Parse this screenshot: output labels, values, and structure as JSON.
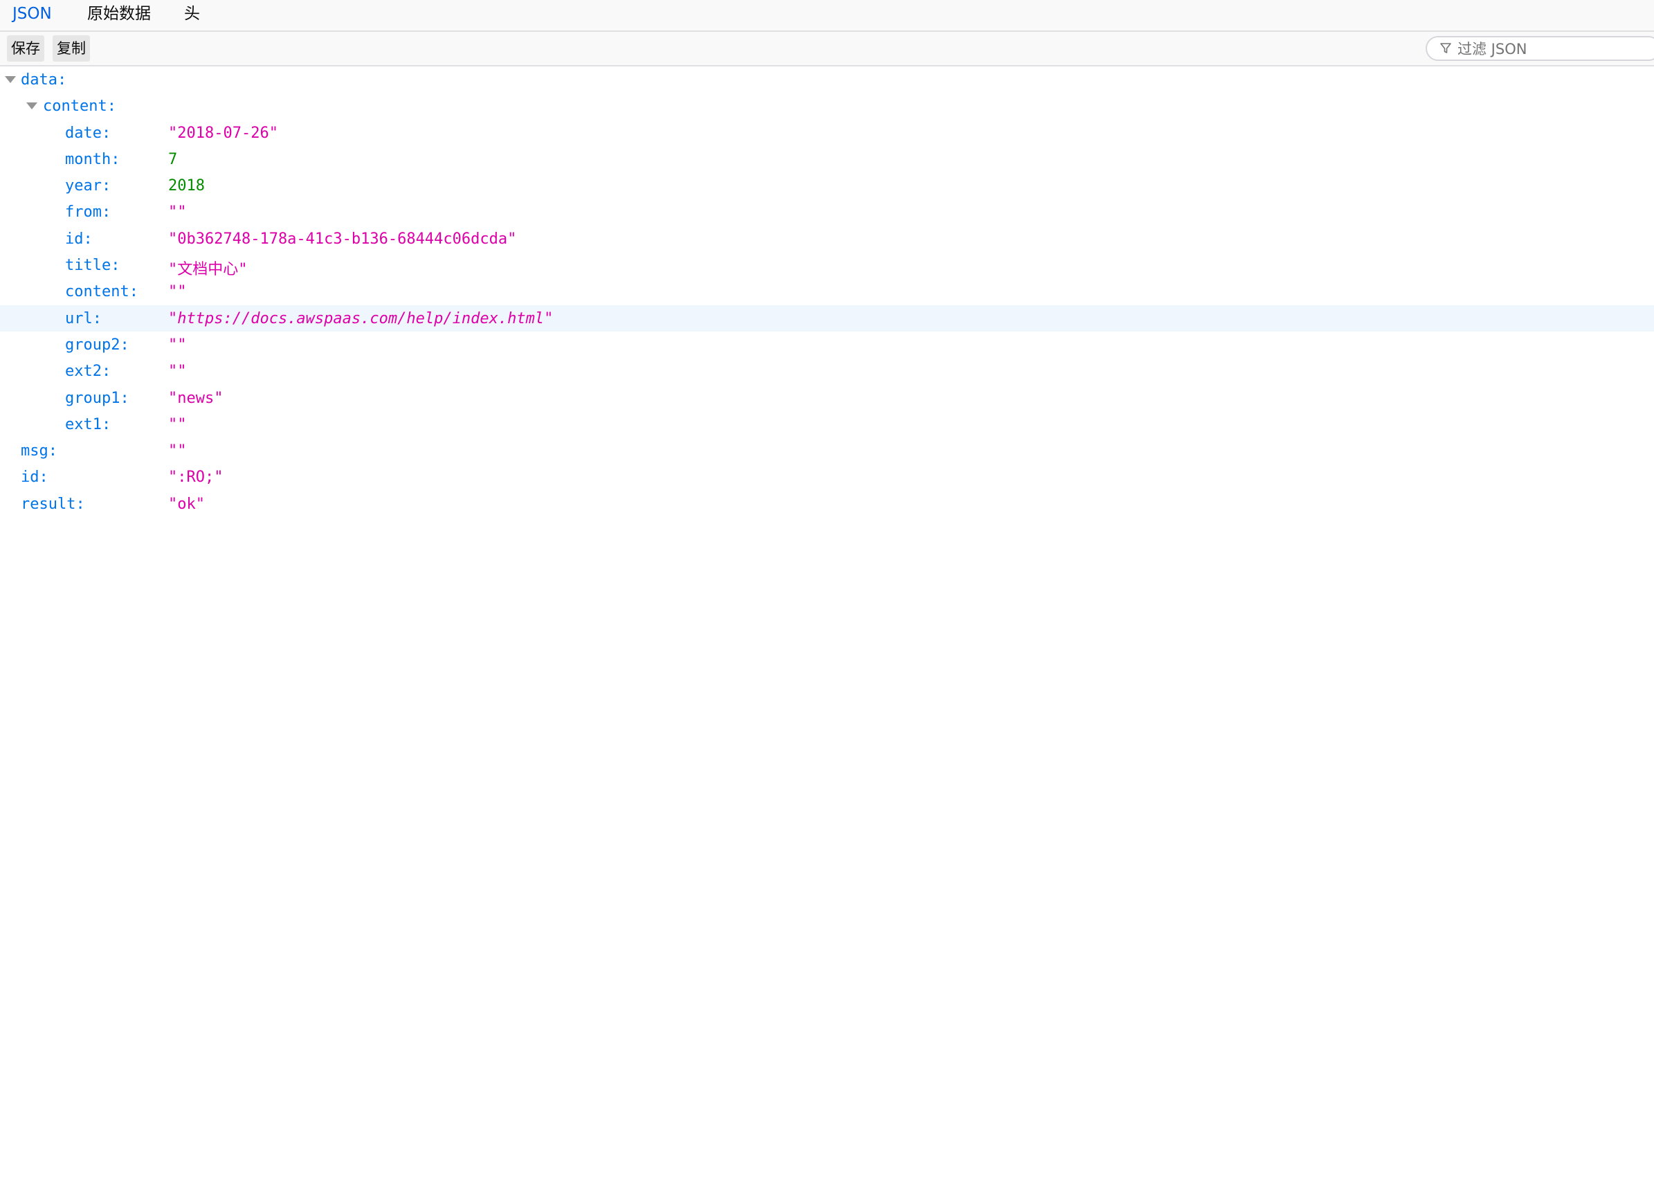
{
  "tabs": {
    "json": "JSON",
    "raw": "原始数据",
    "headers": "头"
  },
  "toolbar": {
    "save_label": "保存",
    "copy_label": "复制",
    "filter_placeholder": "过滤 JSON",
    "filter_icon": "funnel-icon"
  },
  "tree": {
    "data_key": "data:",
    "content_key": "content:",
    "fields": [
      {
        "key": "date:",
        "value": "\"2018-07-26\""
      },
      {
        "key": "month:",
        "value": "7"
      },
      {
        "key": "year:",
        "value": "2018"
      },
      {
        "key": "from:",
        "value": "\"\""
      },
      {
        "key": "id:",
        "value": "\"0b362748-178a-41c3-b136-68444c06dcda\""
      },
      {
        "key": "title:",
        "value": "\"文档中心\""
      },
      {
        "key": "content:",
        "value": "\"\""
      },
      {
        "key": "url:",
        "value_open": "\"",
        "value_link": "https://docs.awspaas.com/help/index.html",
        "value_close": "\""
      },
      {
        "key": "group2:",
        "value": "\"\""
      },
      {
        "key": "ext2:",
        "value": "\"\""
      },
      {
        "key": "group1:",
        "value": "\"news\""
      },
      {
        "key": "ext1:",
        "value": "\"\""
      }
    ],
    "root": [
      {
        "key": "msg:",
        "value": "\"\""
      },
      {
        "key": "id:",
        "value": "\":RO;\""
      },
      {
        "key": "result:",
        "value": "\"ok\""
      }
    ]
  },
  "colors": {
    "key": "#0074e8",
    "string": "#dd00a9",
    "number": "#058b00",
    "active_tab": "#0060df",
    "highlight_row": "#f0f6fe"
  }
}
